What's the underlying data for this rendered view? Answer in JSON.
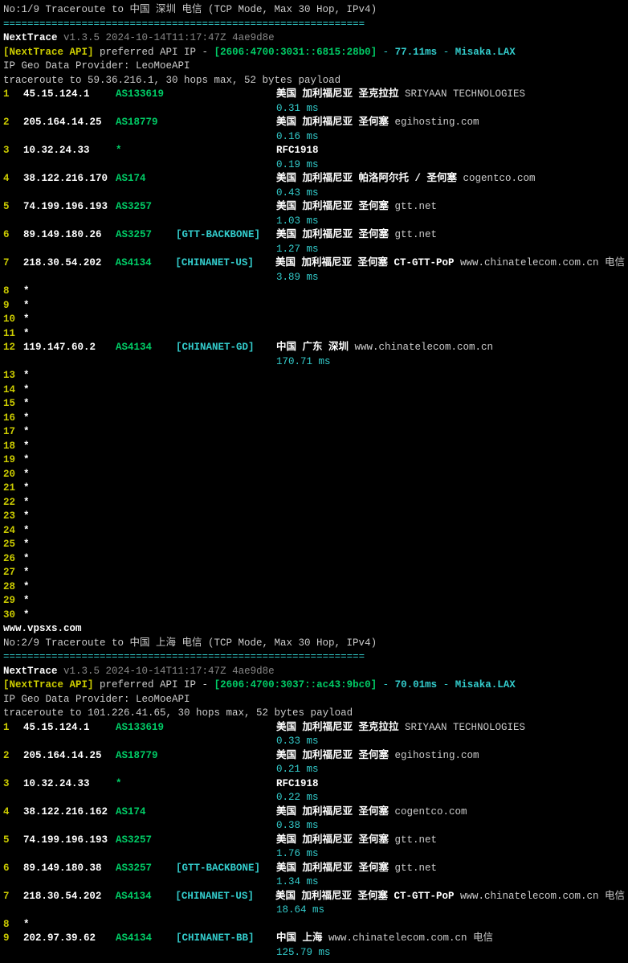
{
  "traces": [
    {
      "header": "No:1/9 Traceroute to 中国 深圳 电信 (TCP Mode, Max 30 Hop, IPv4)",
      "sep": "============================================================",
      "nexttrace_label": "NextTrace",
      "nexttrace_ver": "v1.3.5 2024-10-14T11:17:47Z 4ae9d8e",
      "api_label": "[NextTrace API]",
      "api_text": "preferred API IP -",
      "api_ip": "[2606:4700:3031::6815:28b0]",
      "api_dash": "-",
      "api_ms": "77.11ms",
      "api_dash2": "-",
      "api_loc": "Misaka.LAX",
      "provider": "IP Geo Data Provider: LeoMoeAPI",
      "trace_to": "traceroute to 59.36.216.1, 30 hops max, 52 bytes payload",
      "hops": [
        {
          "n": "1",
          "ip": "45.15.124.1",
          "as": "AS133619",
          "tag": "",
          "loc": "美国 加利福尼亚 圣克拉拉",
          "extra": "SRIYAAN TECHNOLOGIES",
          "lat": "0.31 ms"
        },
        {
          "n": "2",
          "ip": "205.164.14.25",
          "as": "AS18779",
          "tag": "",
          "loc": "美国 加利福尼亚 圣何塞",
          "extra": "egihosting.com",
          "lat": "0.16 ms"
        },
        {
          "n": "3",
          "ip": "10.32.24.33",
          "as": "*",
          "tag": "",
          "loc": "RFC1918",
          "extra": "",
          "lat": "0.19 ms"
        },
        {
          "n": "4",
          "ip": "38.122.216.170",
          "as": "AS174",
          "tag": "",
          "loc": "美国 加利福尼亚 帕洛阿尔托 / 圣何塞",
          "extra": "cogentco.com",
          "lat": "0.43 ms"
        },
        {
          "n": "5",
          "ip": "74.199.196.193",
          "as": "AS3257",
          "tag": "",
          "loc": "美国 加利福尼亚 圣何塞",
          "extra": "gtt.net",
          "lat": "1.03 ms"
        },
        {
          "n": "6",
          "ip": "89.149.180.26",
          "as": "AS3257",
          "tag": "[GTT-BACKBONE]",
          "loc": "美国 加利福尼亚 圣何塞",
          "extra": "gtt.net",
          "lat": "1.27 ms"
        },
        {
          "n": "7",
          "ip": "218.30.54.202",
          "as": "AS4134",
          "tag": "[CHINANET-US]",
          "loc": "美国 加利福尼亚 圣何塞 CT-GTT-PoP",
          "extra": "www.chinatelecom.com.cn  电信",
          "lat": "3.89 ms"
        },
        {
          "n": "8",
          "ip": "*"
        },
        {
          "n": "9",
          "ip": "*"
        },
        {
          "n": "10",
          "ip": "*"
        },
        {
          "n": "11",
          "ip": "*"
        },
        {
          "n": "12",
          "ip": "119.147.60.2",
          "as": "AS4134",
          "tag": "[CHINANET-GD]",
          "loc": "中国 广东 深圳",
          "extra": "www.chinatelecom.com.cn",
          "lat": "170.71 ms"
        },
        {
          "n": "13",
          "ip": "*"
        },
        {
          "n": "14",
          "ip": "*"
        },
        {
          "n": "15",
          "ip": "*"
        },
        {
          "n": "16",
          "ip": "*"
        },
        {
          "n": "17",
          "ip": "*"
        },
        {
          "n": "18",
          "ip": "*"
        },
        {
          "n": "19",
          "ip": "*"
        },
        {
          "n": "20",
          "ip": "*"
        },
        {
          "n": "21",
          "ip": "*"
        },
        {
          "n": "22",
          "ip": "*"
        },
        {
          "n": "23",
          "ip": "*"
        },
        {
          "n": "24",
          "ip": "*"
        },
        {
          "n": "25",
          "ip": "*"
        },
        {
          "n": "26",
          "ip": "*"
        },
        {
          "n": "27",
          "ip": "*"
        },
        {
          "n": "28",
          "ip": "*"
        },
        {
          "n": "29",
          "ip": "*"
        },
        {
          "n": "30",
          "ip": "*"
        }
      ],
      "footer": "www.vpsxs.com"
    },
    {
      "header": "No:2/9 Traceroute to 中国 上海 电信 (TCP Mode, Max 30 Hop, IPv4)",
      "sep": "============================================================",
      "nexttrace_label": "NextTrace",
      "nexttrace_ver": "v1.3.5 2024-10-14T11:17:47Z 4ae9d8e",
      "api_label": "[NextTrace API]",
      "api_text": "preferred API IP -",
      "api_ip": "[2606:4700:3037::ac43:9bc0]",
      "api_dash": "-",
      "api_ms": "70.01ms",
      "api_dash2": "-",
      "api_loc": "Misaka.LAX",
      "provider": "IP Geo Data Provider: LeoMoeAPI",
      "trace_to": "traceroute to 101.226.41.65, 30 hops max, 52 bytes payload",
      "hops": [
        {
          "n": "1",
          "ip": "45.15.124.1",
          "as": "AS133619",
          "tag": "",
          "loc": "美国 加利福尼亚 圣克拉拉",
          "extra": "SRIYAAN TECHNOLOGIES",
          "lat": "0.33 ms"
        },
        {
          "n": "2",
          "ip": "205.164.14.25",
          "as": "AS18779",
          "tag": "",
          "loc": "美国 加利福尼亚 圣何塞",
          "extra": "egihosting.com",
          "lat": "0.21 ms"
        },
        {
          "n": "3",
          "ip": "10.32.24.33",
          "as": "*",
          "tag": "",
          "loc": "RFC1918",
          "extra": "",
          "lat": "0.22 ms"
        },
        {
          "n": "4",
          "ip": "38.122.216.162",
          "as": "AS174",
          "tag": "",
          "loc": "美国 加利福尼亚 圣何塞",
          "extra": "cogentco.com",
          "lat": "0.38 ms"
        },
        {
          "n": "5",
          "ip": "74.199.196.193",
          "as": "AS3257",
          "tag": "",
          "loc": "美国 加利福尼亚 圣何塞",
          "extra": "gtt.net",
          "lat": "1.76 ms"
        },
        {
          "n": "6",
          "ip": "89.149.180.38",
          "as": "AS3257",
          "tag": "[GTT-BACKBONE]",
          "loc": "美国 加利福尼亚 圣何塞",
          "extra": "gtt.net",
          "lat": "1.34 ms"
        },
        {
          "n": "7",
          "ip": "218.30.54.202",
          "as": "AS4134",
          "tag": "[CHINANET-US]",
          "loc": "美国 加利福尼亚 圣何塞 CT-GTT-PoP",
          "extra": "www.chinatelecom.com.cn  电信",
          "lat": "18.64 ms"
        },
        {
          "n": "8",
          "ip": "*"
        },
        {
          "n": "9",
          "ip": "202.97.39.62",
          "as": "AS4134",
          "tag": "[CHINANET-BB]",
          "loc": "中国 上海",
          "extra": "www.chinatelecom.com.cn  电信",
          "lat": "125.79 ms"
        }
      ],
      "footer": ""
    }
  ]
}
